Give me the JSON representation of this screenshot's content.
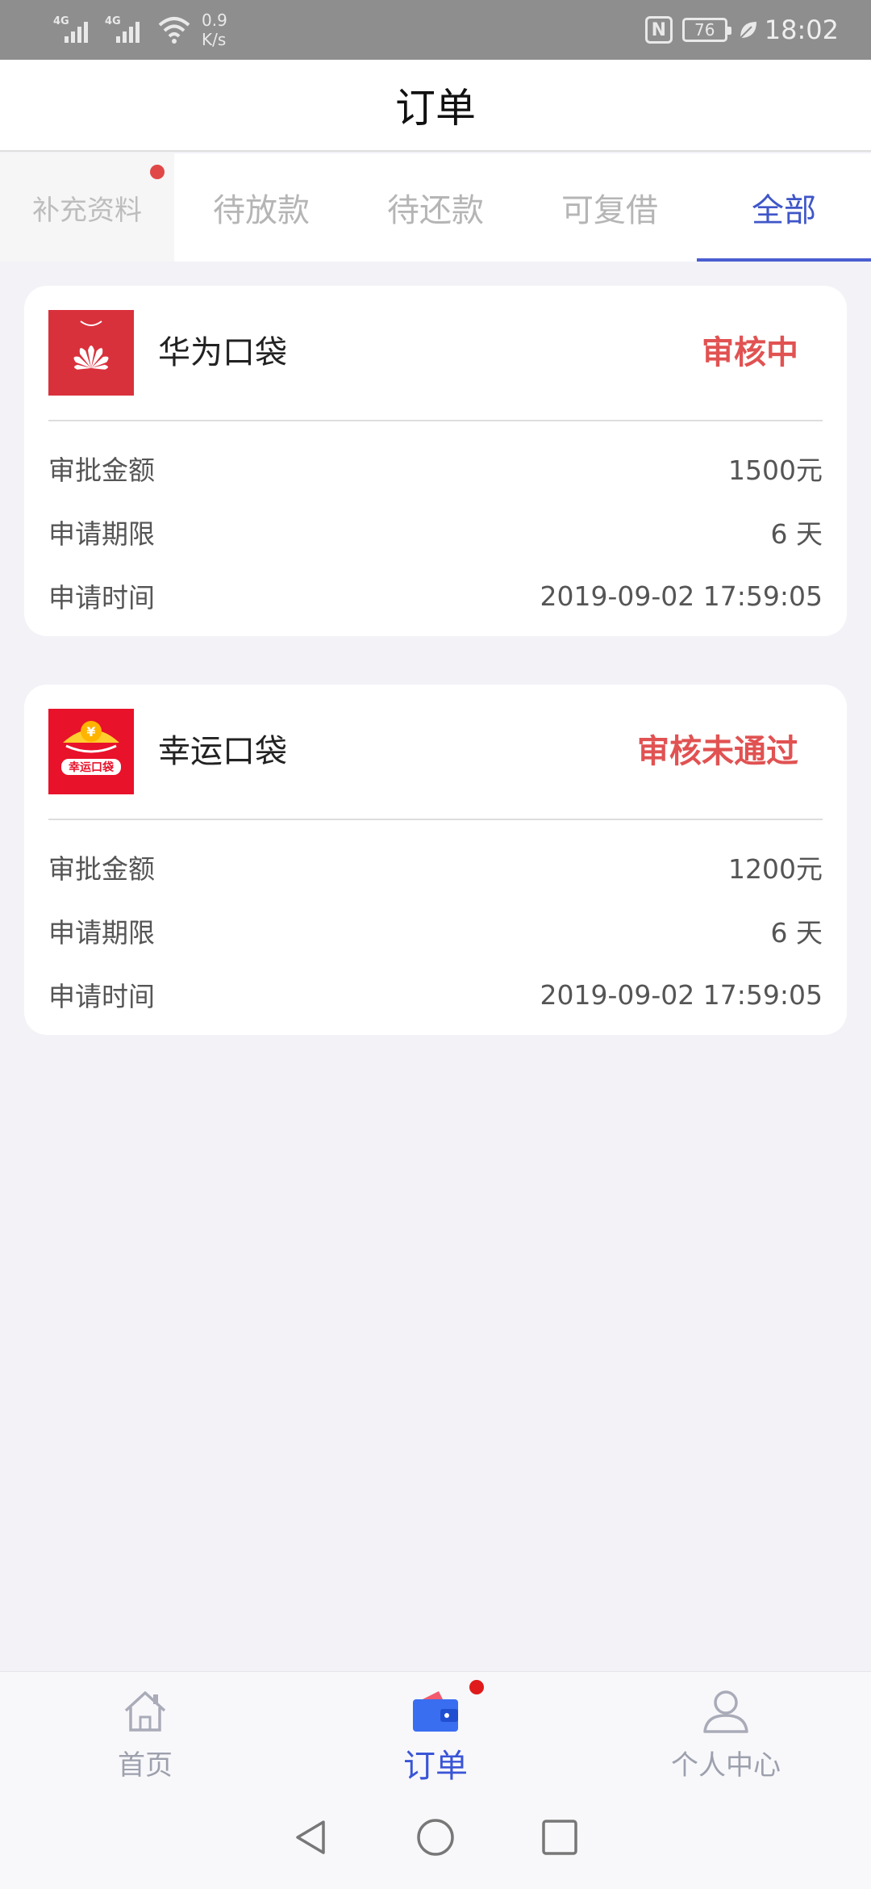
{
  "status_bar": {
    "network_1": "4G",
    "network_2": "4G",
    "speed_value": "0.9",
    "speed_unit": "K/s",
    "nfc": "N",
    "battery": "76",
    "time": "18:02",
    "icon_color": "#e9e9e9",
    "bar_color": "#8e8e8e"
  },
  "header": {
    "title": "订单"
  },
  "tabs": [
    {
      "label": "补充资料",
      "has_dot": true
    },
    {
      "label": "待放款"
    },
    {
      "label": "待还款"
    },
    {
      "label": "可复借"
    },
    {
      "label": "全部",
      "active": true
    }
  ],
  "colors": {
    "accent": "#3f56c8",
    "status_red": "#e15252",
    "badge_red": "#e01b1b"
  },
  "orders": [
    {
      "name": "华为口袋",
      "status": "审核中",
      "logo_icon": "huawei-logo-icon",
      "rows": [
        {
          "label": "审批金额",
          "value": "1500元"
        },
        {
          "label": "申请期限",
          "value": "6 天"
        },
        {
          "label": "申请时间",
          "value": "2019-09-02 17:59:05"
        }
      ]
    },
    {
      "name": "幸运口袋",
      "status": "审核未通过",
      "logo_icon": "lucky-pocket-logo-icon",
      "logo_text": "幸运口袋",
      "logo_glyph": "¥",
      "rows": [
        {
          "label": "审批金额",
          "value": "1200元"
        },
        {
          "label": "申请期限",
          "value": "6 天"
        },
        {
          "label": "申请时间",
          "value": "2019-09-02 17:59:05"
        }
      ]
    }
  ],
  "bottom_nav": [
    {
      "label": "首页",
      "icon": "home-icon"
    },
    {
      "label": "订单",
      "icon": "wallet-icon",
      "active": true,
      "has_dot": true
    },
    {
      "label": "个人中心",
      "icon": "person-icon"
    }
  ]
}
